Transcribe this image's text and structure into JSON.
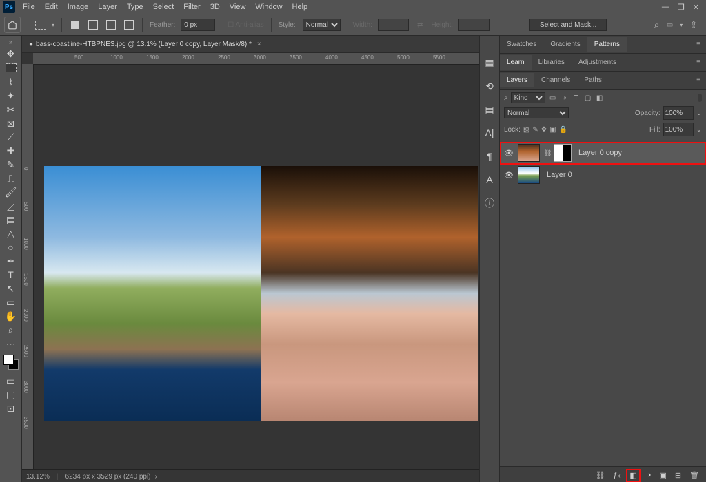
{
  "app": {
    "logo": "Ps"
  },
  "menu": [
    "File",
    "Edit",
    "Image",
    "Layer",
    "Type",
    "Select",
    "Filter",
    "3D",
    "View",
    "Window",
    "Help"
  ],
  "window_controls": {
    "min": "—",
    "restore": "❐",
    "close": "✕"
  },
  "options": {
    "feather_label": "Feather:",
    "feather_value": "0 px",
    "antialias": "Anti-alias",
    "style_label": "Style:",
    "style_value": "Normal",
    "width_label": "Width:",
    "height_label": "Height:",
    "select_mask": "Select and Mask..."
  },
  "right_icons": {
    "search": "⌕",
    "screen": "▭",
    "share": "⇪"
  },
  "tab": {
    "title": "bass-coastline-HTBPNES.jpg @ 13.1% (Layer 0 copy, Layer Mask/8) *",
    "close": "×"
  },
  "ruler_h": [
    "500",
    "1000",
    "1500",
    "2000",
    "2500",
    "3000",
    "3500",
    "4000",
    "4500",
    "5000",
    "5500"
  ],
  "ruler_v": [
    "0",
    "500",
    "1000",
    "1500",
    "2000",
    "2500",
    "3000",
    "3500"
  ],
  "status": {
    "zoom": "13.12%",
    "info": "6234 px x 3529 px (240 ppi)",
    "chev": "›"
  },
  "rail_icons": [
    "▦",
    "⟲",
    "▤",
    "A|",
    "¶",
    "A",
    "ⓘ"
  ],
  "panels": {
    "group1": {
      "tabs": [
        "Swatches",
        "Gradients",
        "Patterns"
      ],
      "active": 2
    },
    "group2": {
      "tabs": [
        "Learn",
        "Libraries",
        "Adjustments"
      ],
      "active": 0
    },
    "group3": {
      "tabs": [
        "Layers",
        "Channels",
        "Paths"
      ],
      "active": 0
    }
  },
  "layers": {
    "search_icon": "⌕",
    "kind": "Kind",
    "filter_icons": [
      "▭",
      "◑",
      "T",
      "▢",
      "◧"
    ],
    "blend": "Normal",
    "opacity_label": "Opacity:",
    "opacity": "100%",
    "chev": "⌄",
    "lock_label": "Lock:",
    "lock_icons": [
      "▧",
      "✎",
      "✥",
      "▣",
      "🔒"
    ],
    "fill_label": "Fill:",
    "fill": "100%",
    "items": [
      {
        "name": "Layer 0 copy",
        "has_mask": true,
        "highlight": true,
        "link": "⛓"
      },
      {
        "name": "Layer 0",
        "has_mask": false,
        "highlight": false
      }
    ],
    "footer": [
      "⛓",
      "ƒₓ",
      "◧",
      "◑",
      "▣",
      "⊞",
      "🗑"
    ],
    "footer_hl": 2
  },
  "tools": [
    {
      "n": "move",
      "g": "✥"
    },
    {
      "n": "marquee",
      "g": ""
    },
    {
      "n": "lasso",
      "g": "⌇"
    },
    {
      "n": "wand",
      "g": "✦"
    },
    {
      "n": "crop",
      "g": "✂"
    },
    {
      "n": "frame",
      "g": "⊠"
    },
    {
      "n": "eyedrop",
      "g": "⟋"
    },
    {
      "n": "heal",
      "g": "✚"
    },
    {
      "n": "brush",
      "g": "✎"
    },
    {
      "n": "stamp",
      "g": "⎍"
    },
    {
      "n": "history",
      "g": "🖌"
    },
    {
      "n": "eraser",
      "g": "◿"
    },
    {
      "n": "gradient",
      "g": "▤"
    },
    {
      "n": "blur",
      "g": "△"
    },
    {
      "n": "dodge",
      "g": "○"
    },
    {
      "n": "pen",
      "g": "✒"
    },
    {
      "n": "type",
      "g": "T"
    },
    {
      "n": "path",
      "g": "↖"
    },
    {
      "n": "rect",
      "g": "▭"
    },
    {
      "n": "hand",
      "g": "✋"
    },
    {
      "n": "zoom",
      "g": "⌕"
    },
    {
      "n": "more",
      "g": "⋯"
    }
  ],
  "edit_icons": [
    "▭",
    "▢",
    "⊡"
  ]
}
